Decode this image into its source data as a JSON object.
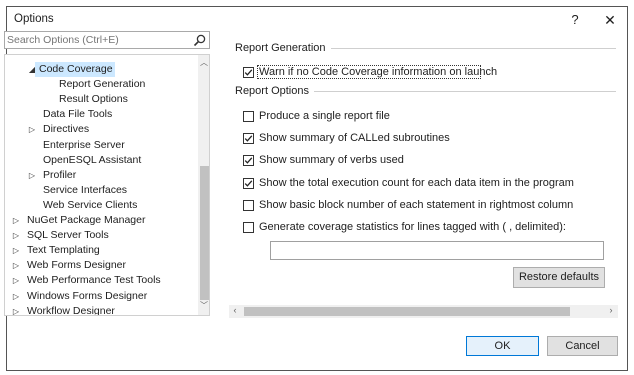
{
  "window": {
    "title": "Options",
    "help_label": "?",
    "close_label": "✕"
  },
  "search": {
    "placeholder": "Search Options (Ctrl+E)"
  },
  "tree": {
    "items": [
      {
        "label": "Code Coverage",
        "arrow": "◢",
        "selected": true
      },
      {
        "label": "Report Generation",
        "arrow": ""
      },
      {
        "label": "Result Options",
        "arrow": ""
      },
      {
        "label": "Data File Tools",
        "arrow": ""
      },
      {
        "label": "Directives",
        "arrow": "▷"
      },
      {
        "label": "Enterprise Server",
        "arrow": ""
      },
      {
        "label": "OpenESQL Assistant",
        "arrow": ""
      },
      {
        "label": "Profiler",
        "arrow": "▷"
      },
      {
        "label": "Service Interfaces",
        "arrow": ""
      },
      {
        "label": "Web Service Clients",
        "arrow": ""
      },
      {
        "label": "NuGet Package Manager",
        "arrow": "▷"
      },
      {
        "label": "SQL Server Tools",
        "arrow": "▷"
      },
      {
        "label": "Text Templating",
        "arrow": "▷"
      },
      {
        "label": "Web Forms Designer",
        "arrow": "▷"
      },
      {
        "label": "Web Performance Test Tools",
        "arrow": "▷"
      },
      {
        "label": "Windows Forms Designer",
        "arrow": "▷"
      },
      {
        "label": "Workflow Designer",
        "arrow": "▷"
      }
    ]
  },
  "report_generation": {
    "heading": "Report Generation",
    "warn_label": "Warn if no Code Coverage information on launch",
    "warn_checked": true
  },
  "report_options": {
    "heading": "Report Options",
    "options": [
      {
        "label": "Produce a single report file",
        "checked": false
      },
      {
        "label": "Show summary of CALLed subroutines",
        "checked": true
      },
      {
        "label": "Show summary of verbs used",
        "checked": true
      },
      {
        "label": "Show the total execution count for each data item in the program",
        "checked": true
      },
      {
        "label": "Show basic block number of each statement in rightmost column",
        "checked": false
      },
      {
        "label": "Generate coverage statistics for lines tagged with ( , delimited):",
        "checked": false
      }
    ],
    "delimited_value": ""
  },
  "buttons": {
    "restore": "Restore defaults",
    "ok": "OK",
    "cancel": "Cancel"
  }
}
